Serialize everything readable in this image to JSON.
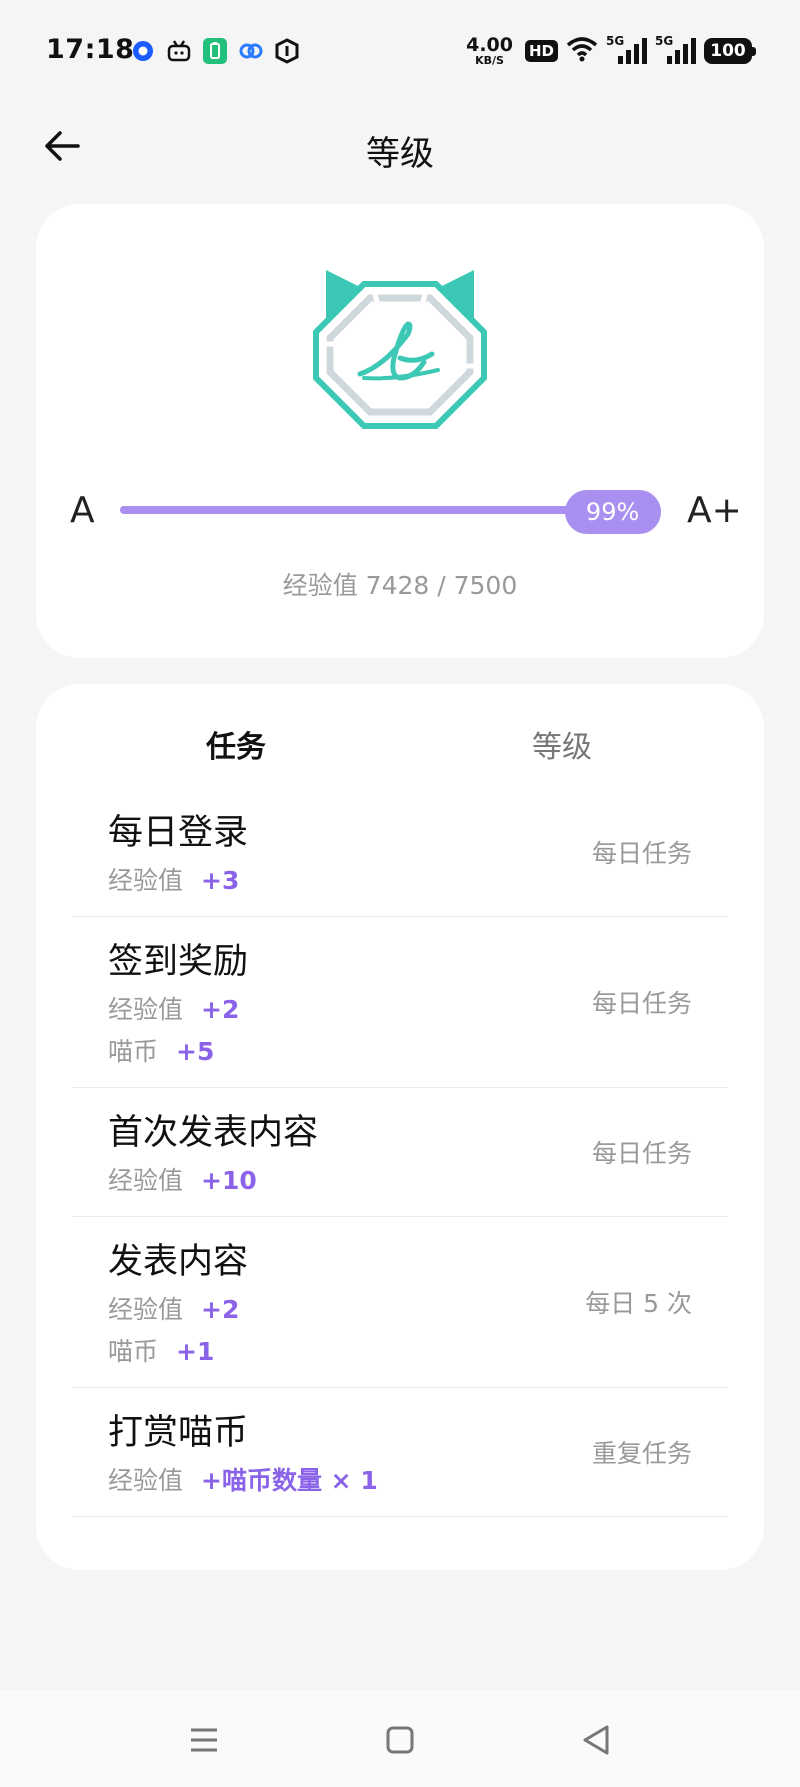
{
  "status_bar": {
    "time": "17:18",
    "net_speed_value": "4.00",
    "net_speed_unit": "KB/S",
    "hd_label": "HD",
    "sim1_gen": "5G",
    "sim2_gen": "5G",
    "battery": "100",
    "app_icons": [
      "circle-app-icon",
      "tv-app-icon",
      "battery-saver-icon",
      "link-app-icon",
      "hexagon-app-icon"
    ]
  },
  "header": {
    "title": "等级",
    "back_icon": "arrow-left-icon"
  },
  "level": {
    "current": "A",
    "next": "A+",
    "progress_label": "99%",
    "progress": 0.99,
    "exp_text": "经验值 7428 / 7500",
    "badge_icon": "cat-level-badge-icon",
    "accent": "#a98ff0",
    "badge_color": "#3cc8b4"
  },
  "tabs": [
    {
      "label": "任务",
      "active": true
    },
    {
      "label": "等级",
      "active": false
    }
  ],
  "tasks": [
    {
      "title": "每日登录",
      "rewards": [
        {
          "label": "经验值",
          "value": "+3"
        }
      ],
      "type": "每日任务"
    },
    {
      "title": "签到奖励",
      "rewards": [
        {
          "label": "经验值",
          "value": "+2"
        },
        {
          "label": "喵币",
          "value": "+5"
        }
      ],
      "type": "每日任务"
    },
    {
      "title": "首次发表内容",
      "rewards": [
        {
          "label": "经验值",
          "value": "+10"
        }
      ],
      "type": "每日任务"
    },
    {
      "title": "发表内容",
      "rewards": [
        {
          "label": "经验值",
          "value": "+2"
        },
        {
          "label": "喵币",
          "value": "+1"
        }
      ],
      "type": "每日 5 次"
    },
    {
      "title": "打赏喵币",
      "rewards": [
        {
          "label": "经验值",
          "value": "+喵币数量 × 1"
        }
      ],
      "type": "重复任务"
    }
  ],
  "nav_bar": {
    "icons": [
      "menu-icon",
      "home-square-icon",
      "back-triangle-icon"
    ]
  },
  "colors": {
    "reward_value": "#8a63e8",
    "background": "#f5f5f5"
  }
}
